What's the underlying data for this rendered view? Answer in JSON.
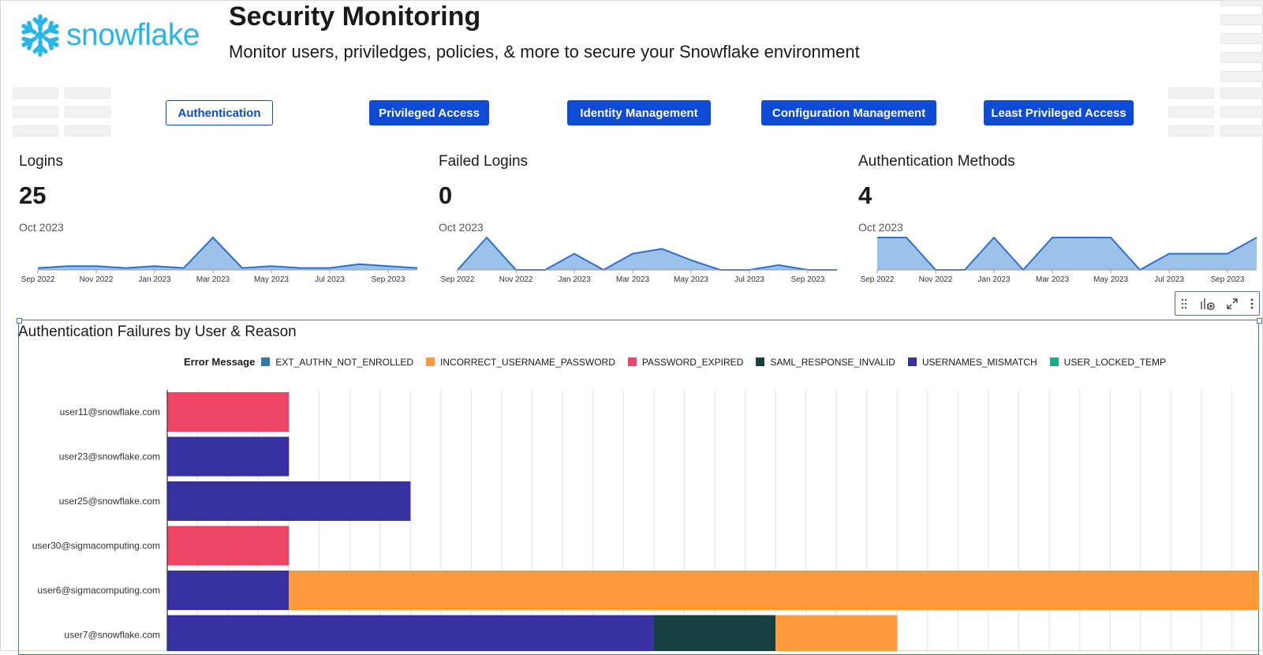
{
  "header": {
    "brand": "snowflake",
    "title": "Security Monitoring",
    "subtitle": "Monitor users, priviledges, policies, & more to secure your Snowflake environment",
    "logo_icon": "snowflake-icon",
    "brand_color": "#29b5e8"
  },
  "tabs": [
    {
      "label": "Authentication",
      "active": true
    },
    {
      "label": "Privileged Access",
      "active": false
    },
    {
      "label": "Identity Management",
      "active": false
    },
    {
      "label": "Configuration Management",
      "active": false
    },
    {
      "label": "Least Privileged Access",
      "active": false
    }
  ],
  "kpis": [
    {
      "label": "Logins",
      "value": "25",
      "date": "Oct 2023"
    },
    {
      "label": "Failed Logins",
      "value": "0",
      "date": "Oct 2023"
    },
    {
      "label": "Authentication Methods",
      "value": "4",
      "date": "Oct 2023"
    }
  ],
  "toolbar": {
    "icons": [
      "drag-handle-icon",
      "add-chart-icon",
      "expand-icon",
      "more-icon"
    ]
  },
  "chart_data": [
    {
      "type": "area",
      "x": [
        "Sep 2022",
        "Oct 2022",
        "Nov 2022",
        "Dec 2022",
        "Jan 2023",
        "Feb 2023",
        "Mar 2023",
        "Apr 2023",
        "May 2023",
        "Jun 2023",
        "Jul 2023",
        "Aug 2023",
        "Sep 2023",
        "Oct 2023"
      ],
      "tick_labels": [
        "Sep 2022",
        "Nov 2022",
        "Jan 2023",
        "Mar 2023",
        "May 2023",
        "Jul 2023",
        "Sep 2023"
      ],
      "values": [
        1,
        2,
        2,
        1,
        2,
        1,
        17,
        1,
        2,
        1,
        1,
        3,
        2,
        1
      ],
      "ylim": [
        0,
        17
      ],
      "color": "#2d6fd1",
      "fill": "#9cc2ea"
    },
    {
      "type": "area",
      "x": [
        "Sep 2022",
        "Oct 2022",
        "Nov 2022",
        "Dec 2022",
        "Jan 2023",
        "Feb 2023",
        "Mar 2023",
        "Apr 2023",
        "May 2023",
        "Jun 2023",
        "Jul 2023",
        "Aug 2023",
        "Sep 2023",
        "Oct 2023"
      ],
      "tick_labels": [
        "Sep 2022",
        "Nov 2022",
        "Jan 2023",
        "Mar 2023",
        "May 2023",
        "Jul 2023",
        "Sep 2023"
      ],
      "values": [
        0,
        10,
        0,
        0,
        5,
        0,
        5,
        6.5,
        3,
        0,
        0,
        1.5,
        0,
        0
      ],
      "ylim": [
        0,
        10
      ],
      "color": "#2d6fd1",
      "fill": "#9cc2ea"
    },
    {
      "type": "area",
      "x": [
        "Sep 2022",
        "Oct 2022",
        "Nov 2022",
        "Dec 2022",
        "Jan 2023",
        "Feb 2023",
        "Mar 2023",
        "Apr 2023",
        "May 2023",
        "Jun 2023",
        "Jul 2023",
        "Aug 2023",
        "Sep 2023",
        "Oct 2023"
      ],
      "tick_labels": [
        "Sep 2022",
        "Nov 2022",
        "Jan 2023",
        "Mar 2023",
        "May 2023",
        "Jul 2023",
        "Sep 2023"
      ],
      "values": [
        2,
        2,
        0,
        0,
        2,
        0,
        2,
        2,
        2,
        0,
        1,
        1,
        1,
        2
      ],
      "ylim": [
        0,
        2
      ],
      "color": "#2d6fd1",
      "fill": "#9cc2ea"
    },
    {
      "type": "bar",
      "orientation": "horizontal",
      "stacked": true,
      "title": "Authentication Failures by User & Reason",
      "legend_title": "Error Message",
      "legend_position": "top",
      "categories": [
        "user11@snowflake.com",
        "user23@snowflake.com",
        "user25@snowflake.com",
        "user30@sigmacomputing.com",
        "user6@sigmacomputing.com",
        "user7@snowflake.com"
      ],
      "series": [
        {
          "name": "EXT_AUTHN_NOT_ENROLLED",
          "color": "#2b7bab",
          "values": [
            0,
            0,
            0,
            0,
            0,
            0
          ]
        },
        {
          "name": "INCORRECT_USERNAME_PASSWORD",
          "color": "#ff9a3c",
          "values": [
            0,
            0,
            0,
            0,
            16,
            2
          ]
        },
        {
          "name": "PASSWORD_EXPIRED",
          "color": "#ef4565",
          "values": [
            2,
            0,
            0,
            2,
            0,
            0
          ]
        },
        {
          "name": "SAML_RESPONSE_INVALID",
          "color": "#16403f",
          "values": [
            0,
            0,
            0,
            0,
            0,
            2
          ]
        },
        {
          "name": "USERNAMES_MISMATCH",
          "color": "#3730a3",
          "values": [
            0,
            2,
            4,
            0,
            2,
            8
          ]
        },
        {
          "name": "USER_LOCKED_TEMP",
          "color": "#1aab8a",
          "values": [
            0,
            0,
            0,
            0,
            0,
            0
          ]
        }
      ],
      "xlim": [
        0,
        18
      ],
      "grid": true
    }
  ]
}
